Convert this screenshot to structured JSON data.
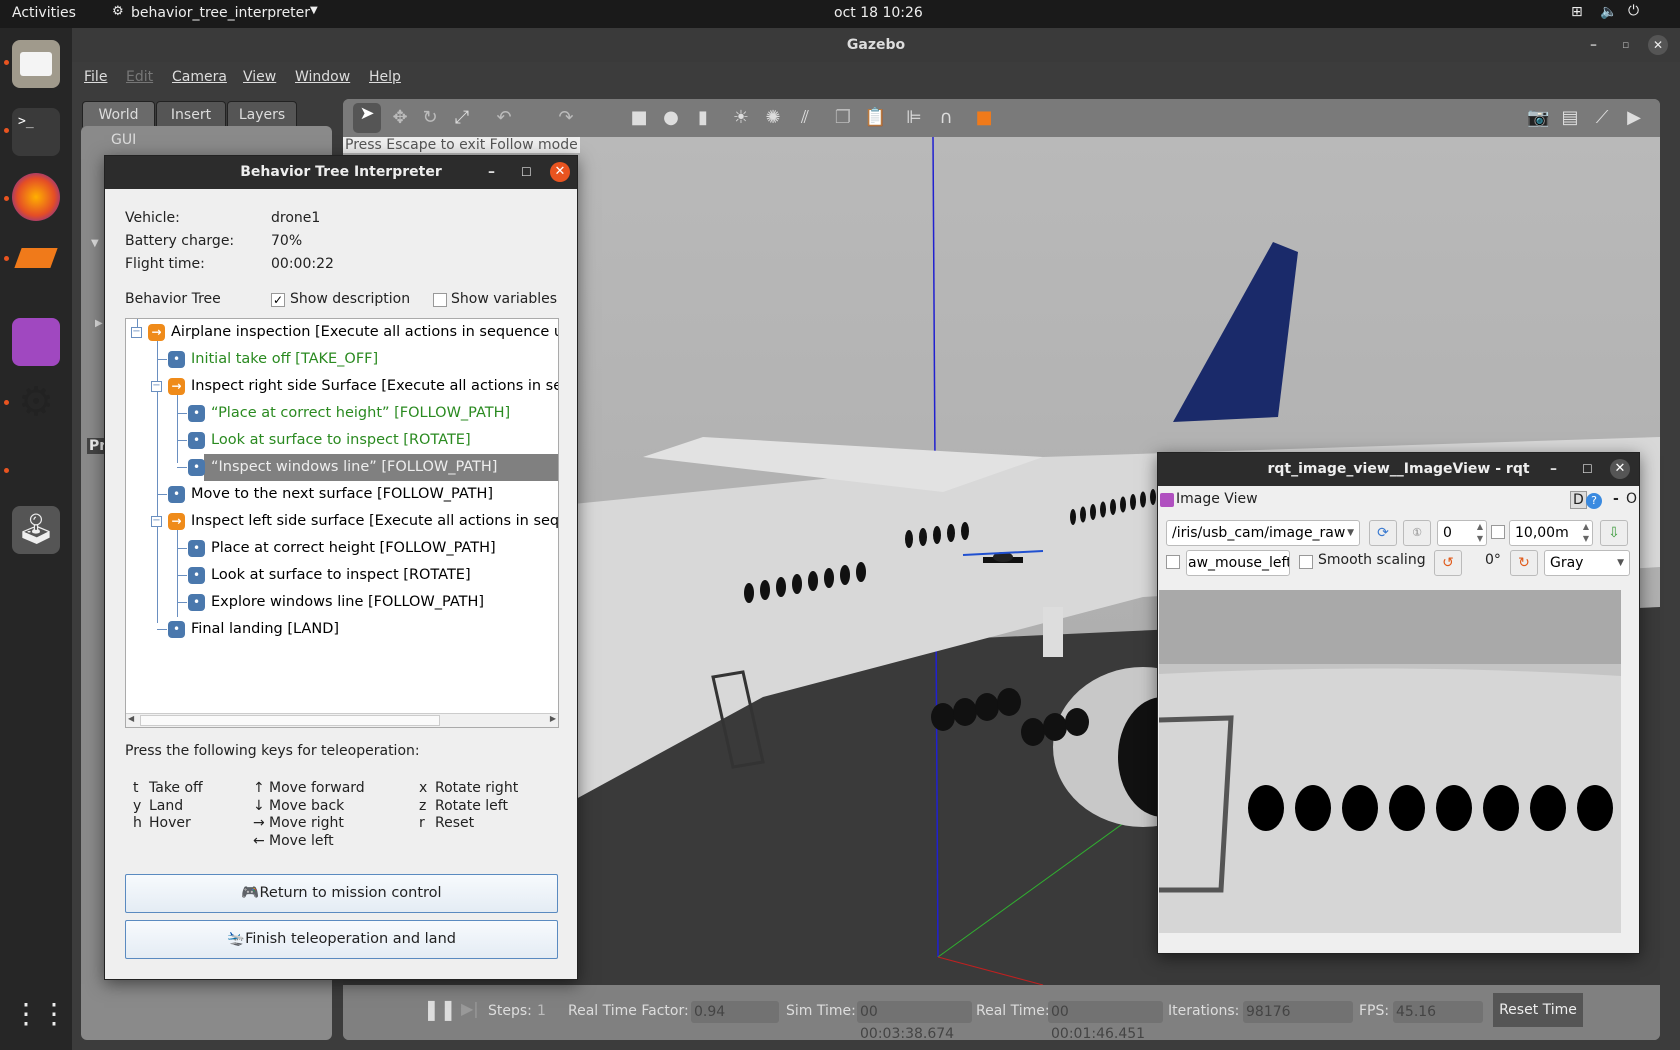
{
  "topbar": {
    "activities": "Activities",
    "app": "behavior_tree_interpreter",
    "clock": "oct 18  10:26"
  },
  "gazebo": {
    "title": "Gazebo",
    "menu": [
      "File",
      "Edit",
      "Camera",
      "View",
      "Window",
      "Help"
    ],
    "tabs": [
      "World",
      "Insert",
      "Layers"
    ],
    "panel_item": "GUI",
    "panel_partial": "Pr",
    "follow_notice": "Press Escape to exit Follow mode",
    "bottom": {
      "steps_label": "Steps:",
      "steps": "1",
      "rtf_label": "Real Time Factor:",
      "rtf": "0.94",
      "sim_label": "Sim Time:",
      "sim": "00 00:03:38.674",
      "real_label": "Real Time:",
      "real": "00 00:01:46.451",
      "iter_label": "Iterations:",
      "iter": "98176",
      "fps_label": "FPS:",
      "fps": "45.16",
      "reset": "Reset Time"
    }
  },
  "bt": {
    "title": "Behavior Tree Interpreter",
    "vehicle_label": "Vehicle:",
    "vehicle": "drone1",
    "battery_label": "Battery charge:",
    "battery": "70%",
    "flight_label": "Flight time:",
    "flight": "00:00:22",
    "tree_label": "Behavior Tree",
    "show_desc": "Show description",
    "show_desc_checked": true,
    "show_vars": "Show variables",
    "show_vars_checked": false,
    "nodes": [
      {
        "label": "Airplane inspection [Execute all actions in sequence until",
        "type": "sequence",
        "state": "normal"
      },
      {
        "label": "Initial take off [TAKE_OFF]",
        "type": "action",
        "state": "success"
      },
      {
        "label": "Inspect right side Surface [Execute all actions in seque",
        "type": "sequence",
        "state": "normal"
      },
      {
        "label": "“Place at correct height” [FOLLOW_PATH]",
        "type": "action",
        "state": "success"
      },
      {
        "label": "Look at surface to inspect [ROTATE]",
        "type": "action",
        "state": "success"
      },
      {
        "label": "“Inspect windows line” [FOLLOW_PATH]",
        "type": "action",
        "state": "running"
      },
      {
        "label": "Move to the next surface [FOLLOW_PATH]",
        "type": "action",
        "state": "normal"
      },
      {
        "label": "Inspect left side surface [Execute all actions in sequen",
        "type": "sequence",
        "state": "normal"
      },
      {
        "label": "Place at correct height [FOLLOW_PATH]",
        "type": "action",
        "state": "normal"
      },
      {
        "label": "Look at surface to inspect [ROTATE]",
        "type": "action",
        "state": "normal"
      },
      {
        "label": "Explore windows line [FOLLOW_PATH]",
        "type": "action",
        "state": "normal"
      },
      {
        "label": "Final landing [LAND]",
        "type": "action",
        "state": "normal"
      }
    ],
    "teleop_title": "Press the following keys for teleoperation:",
    "keys": [
      [
        [
          "t",
          "Take off"
        ],
        [
          "y",
          "Land"
        ],
        [
          "h",
          "Hover"
        ]
      ],
      [
        [
          "↑",
          "Move forward"
        ],
        [
          "↓",
          "Move back"
        ],
        [
          "→",
          "Move right"
        ],
        [
          "←",
          "Move left"
        ]
      ],
      [
        [
          "x",
          "Rotate right"
        ],
        [
          "z",
          "Rotate left"
        ],
        [
          "r",
          "Reset"
        ]
      ]
    ],
    "btn_return": "Return to mission control",
    "btn_finish": "Finish teleoperation and land"
  },
  "rqt": {
    "title": "rqt_image_view__ImageView - rqt",
    "plugin": "Image View",
    "d": "D",
    "help": "?",
    "dash": "-",
    "o": "O",
    "topic": "/iris/usb_cam/image_raw",
    "num": "0",
    "max": "10,00m",
    "mouse_topic": "aw_mouse_left",
    "smooth": "Smooth scaling",
    "rotation": "0°",
    "colormap": "Gray"
  },
  "colors": {
    "accent": "#e95420",
    "success": "#2a8a20",
    "sequence": "#ef8b1a",
    "action": "#4a78ad"
  }
}
